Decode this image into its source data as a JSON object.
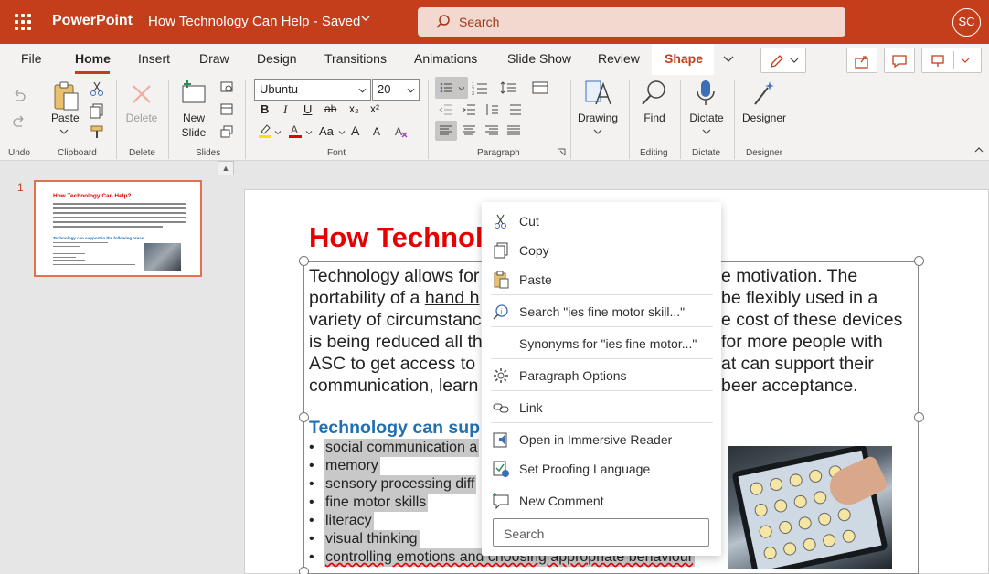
{
  "titlebar": {
    "app_name": "PowerPoint",
    "doc_title": "How Technology Can Help  -  Saved",
    "search_placeholder": "Search",
    "avatar_initials": "SC"
  },
  "tabs": [
    "File",
    "Home",
    "Insert",
    "Draw",
    "Design",
    "Transitions",
    "Animations",
    "Slide Show",
    "Review",
    "Shape"
  ],
  "ribbon": {
    "groups": {
      "undo": "Undo",
      "clipboard": "Clipboard",
      "delete": "Delete",
      "slides": "Slides",
      "font": "Font",
      "paragraph": "Paragraph",
      "editing": "Editing",
      "dictate": "Dictate",
      "designer": "Designer"
    },
    "paste_label": "Paste",
    "delete_label": "Delete",
    "new_slide_label_1": "New",
    "new_slide_label_2": "Slide",
    "font_name": "Ubuntu",
    "font_size": "20",
    "drawing_label": "Drawing",
    "find_label": "Find",
    "dictate_label": "Dictate",
    "designer_label": "Designer",
    "bold": "B",
    "italic": "I",
    "underline": "U",
    "strike": "ab",
    "subscript": "x₂",
    "superscript": "x²",
    "change_case": "Aa",
    "grow": "A",
    "shrink": "A"
  },
  "slide_panel": {
    "slide_number": "1",
    "thumb_title": "How Technology Can Help?",
    "thumb_subhead": "Technology can support in the following areas:"
  },
  "slide": {
    "title": "How Technolo",
    "body": "Technology allows for                                  e motivation. The portability of a hand h                              be flexibly used in a variety of circumstanc                            e cost of these devices is being reduced all th                          for more people with ASC to get access to                              at can support their communication, learn                                beer acceptance.",
    "body_link": "hand h",
    "subheading": "Technology can sup",
    "bullets": [
      "social communication a",
      "memory",
      "sensory processing diff",
      "fine motor skills",
      "literacy",
      "visual thinking",
      "controlling emotions and choosing appropriate behaviour"
    ]
  },
  "context_menu": {
    "items": [
      {
        "label": "Cut",
        "icon": "scissors-icon"
      },
      {
        "label": "Copy",
        "icon": "copy-icon"
      },
      {
        "label": "Paste",
        "icon": "paste-icon"
      },
      {
        "label": "Search \"ies fine motor skill...\"",
        "icon": "smart-lookup-icon"
      },
      {
        "label": "Synonyms for \"ies fine motor...\"",
        "icon": ""
      },
      {
        "label": "Paragraph Options",
        "icon": "gear-icon"
      },
      {
        "label": "Link",
        "icon": "link-icon"
      },
      {
        "label": "Open in Immersive Reader",
        "icon": "immersive-reader-icon"
      },
      {
        "label": "Set Proofing Language",
        "icon": "proofing-language-icon"
      },
      {
        "label": "New Comment",
        "icon": "comment-icon"
      }
    ],
    "search_placeholder": "Search"
  },
  "colors": {
    "brand": "#c43e1c",
    "title_red": "#e60000",
    "subhead_blue": "#1f6fb2"
  }
}
